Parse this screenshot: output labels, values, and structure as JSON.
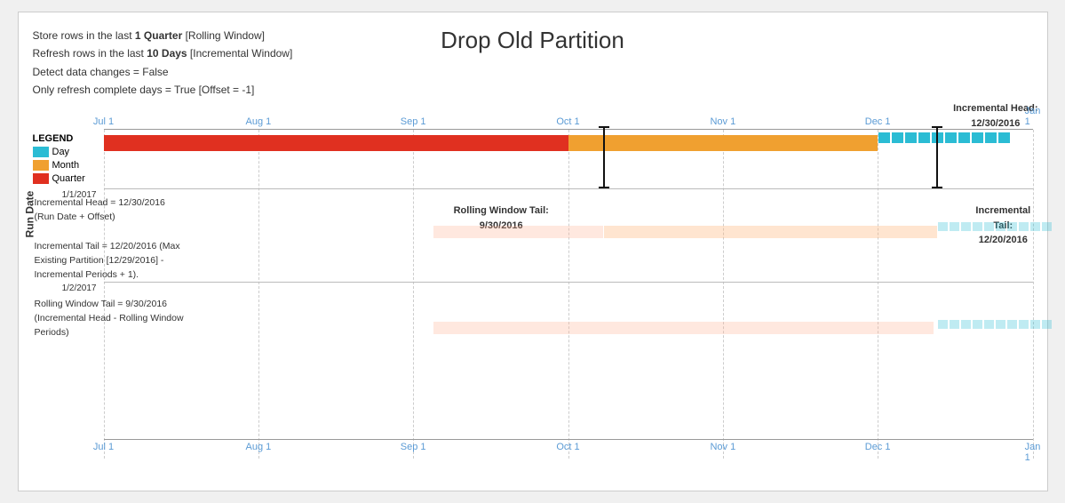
{
  "title": "Drop Old Partition",
  "info": {
    "line1_pre": "Store rows in the last ",
    "line1_bold": "1 Quarter",
    "line1_post": " [Rolling Window]",
    "line2_pre": "Refresh rows in the last ",
    "line2_bold": "10 Days",
    "line2_post": " [Incremental Window]",
    "line3": "Detect data changes = False",
    "line4": "Only refresh complete days = True [Offset = -1]"
  },
  "legend": {
    "title": "LEGEND",
    "items": [
      {
        "label": "Day",
        "color": "#2bbcd4"
      },
      {
        "label": "Month",
        "color": "#f0a030"
      },
      {
        "label": "Quarter",
        "color": "#e03020"
      }
    ]
  },
  "axis": {
    "labels": [
      "Jul 1",
      "Aug 1",
      "Sep 1",
      "Oct 1",
      "Nov 1",
      "Dec 1",
      "Jan 1"
    ],
    "positions": [
      0,
      16.67,
      33.33,
      50.0,
      66.67,
      83.33,
      100.0
    ]
  },
  "incremental_head_label": "Incremental Head:\n12/30/2016",
  "annotations": {
    "block1": {
      "line1": "Incremental Head = 12/30/2016",
      "line2": "(Run Date + Offset)",
      "line3": "",
      "line4": "Incremental Tail = 12/20/2016 (Max",
      "line5": "Existing Partition [12/29/2016] -",
      "line6": "Incremental Periods + 1).",
      "line7": "",
      "line8": "Rolling Window Tail = 9/30/2016",
      "line9": "(Incremental Head - Rolling Window",
      "line10": "Periods)"
    },
    "rolling_window_tail": "Rolling Window Tail:\n9/30/2016",
    "incremental_tail_label": "Incremental Tail:\n12/20/2016"
  },
  "run_dates": {
    "label": "Run Date",
    "dates": [
      "1/1/2017",
      "1/2/2017"
    ]
  },
  "colors": {
    "day": "#2bbcd4",
    "month": "#f0a030",
    "quarter": "#e03020",
    "day_light": "#b8e8f0",
    "month_light": "#fde8c8",
    "day_hatched": "#2bbcd4"
  }
}
